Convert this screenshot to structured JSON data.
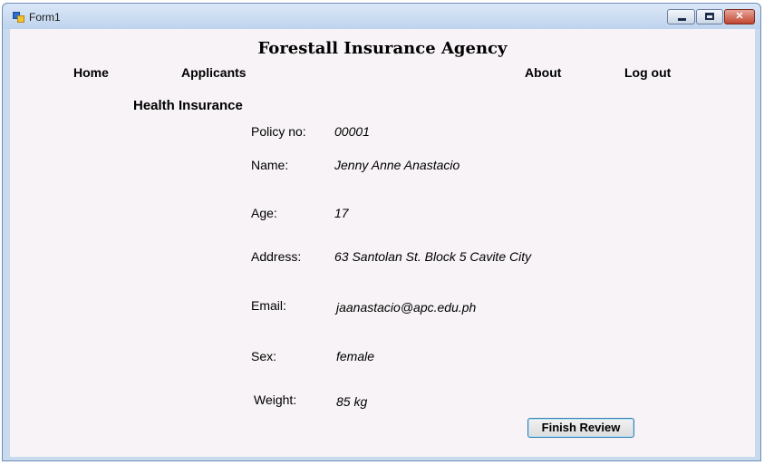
{
  "window": {
    "title": "Form1",
    "buttons": {
      "minimize": "",
      "maximize": "",
      "close": "✕"
    }
  },
  "header": {
    "agency_name": "Forestall Insurance Agency"
  },
  "menu": {
    "home": "Home",
    "applicants": "Applicants",
    "about": "About",
    "logout": "Log out"
  },
  "section": {
    "title": "Health Insurance"
  },
  "fields": {
    "policy_no": {
      "label": "Policy no:",
      "value": "00001"
    },
    "name": {
      "label": "Name:",
      "value": "Jenny Anne Anastacio"
    },
    "age": {
      "label": "Age:",
      "value": "17"
    },
    "address": {
      "label": "Address:",
      "value": "63 Santolan St. Block 5 Cavite City"
    },
    "email": {
      "label": "Email:",
      "value": "jaanastacio@apc.edu.ph"
    },
    "sex": {
      "label": "Sex:",
      "value": "female"
    },
    "weight": {
      "label": "Weight:",
      "value": "85 kg"
    }
  },
  "actions": {
    "finish_review": "Finish Review"
  },
  "icons": {
    "app": "app-form-icon",
    "minimize": "minimize-icon",
    "maximize": "maximize-icon",
    "close": "close-icon"
  }
}
